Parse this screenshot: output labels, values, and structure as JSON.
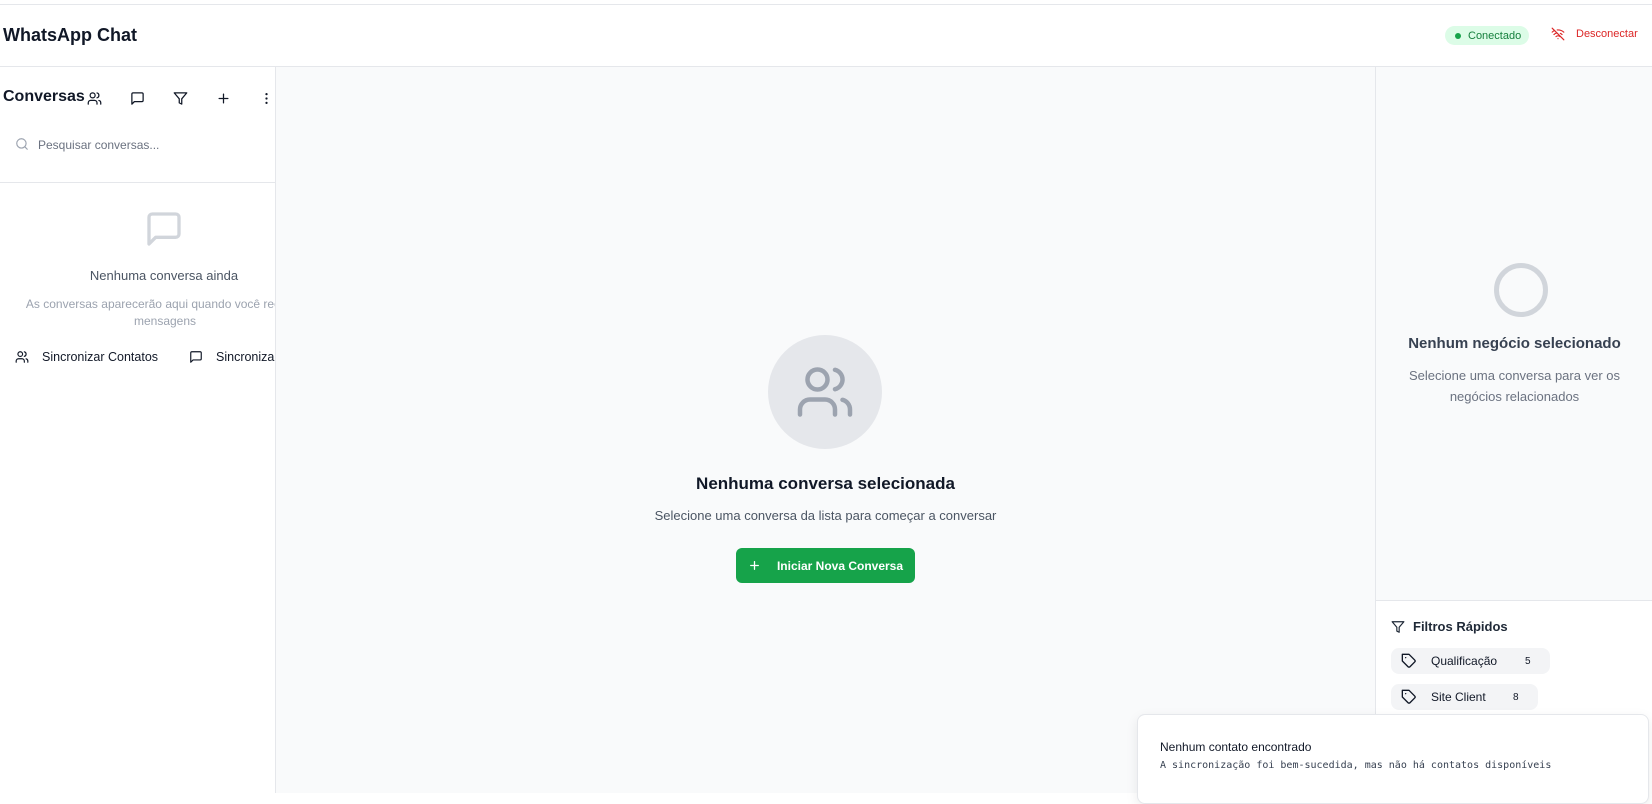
{
  "header": {
    "title": "WhatsApp Chat",
    "status": "Conectado",
    "disconnect_label": "Desconectar"
  },
  "sidebar": {
    "title": "Conversas",
    "search_placeholder": "Pesquisar conversas...",
    "empty_title": "Nenhuma conversa ainda",
    "empty_subtitle": "As conversas aparecerão aqui quando você receber mensagens",
    "sync_contacts_label": "Sincronizar Contatos",
    "sync_conversations_label": "Sincronizar Conversas",
    "toolbar_icons": [
      "users-icon",
      "message-icon",
      "filter-icon",
      "plus-icon",
      "more-vertical-icon"
    ]
  },
  "main": {
    "title": "Nenhuma conversa selecionada",
    "subtitle": "Selecione uma conversa da lista para começar a conversar",
    "new_conversation_label": "Iniciar Nova Conversa"
  },
  "right_panel": {
    "title": "Nenhum negócio selecionado",
    "subtitle": "Selecione uma conversa para ver os negócios relacionados",
    "filters_title": "Filtros Rápidos",
    "filters": [
      {
        "label": "Qualificação",
        "count": "5"
      },
      {
        "label": "Site Client",
        "count": "8"
      }
    ]
  },
  "toast": {
    "title": "Nenhum contato encontrado",
    "description": "A sincronização foi bem-sucedida, mas não há contatos disponíveis"
  },
  "colors": {
    "accent": "#16a34a",
    "status_bg": "#dcfce7",
    "danger": "#dc2626"
  }
}
